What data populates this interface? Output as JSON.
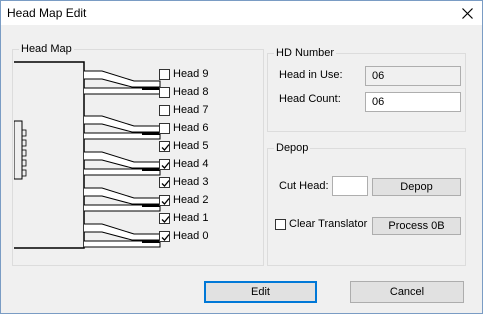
{
  "window": {
    "title": "Head Map Edit",
    "close_glyph": "✕"
  },
  "head_map": {
    "label": "Head Map",
    "heads": [
      {
        "label": "Head 9",
        "checked": false
      },
      {
        "label": "Head 8",
        "checked": false
      },
      {
        "label": "Head 7",
        "checked": false
      },
      {
        "label": "Head 6",
        "checked": false
      },
      {
        "label": "Head 5",
        "checked": true
      },
      {
        "label": "Head 4",
        "checked": true
      },
      {
        "label": "Head 3",
        "checked": true
      },
      {
        "label": "Head 2",
        "checked": true
      },
      {
        "label": "Head 1",
        "checked": true
      },
      {
        "label": "Head 0",
        "checked": true
      }
    ]
  },
  "hd_number": {
    "label": "HD Number",
    "head_in_use_label": "Head in Use:",
    "head_in_use_value": "06",
    "head_count_label": "Head Count:",
    "head_count_value": "06"
  },
  "depop": {
    "label": "Depop",
    "cut_head_label": "Cut Head:",
    "cut_head_value": "",
    "depop_button": "Depop",
    "clear_translator_label": "Clear Translator",
    "clear_translator_checked": false,
    "process_button": "Process 0B"
  },
  "footer": {
    "edit_button": "Edit",
    "cancel_button": "Cancel"
  }
}
